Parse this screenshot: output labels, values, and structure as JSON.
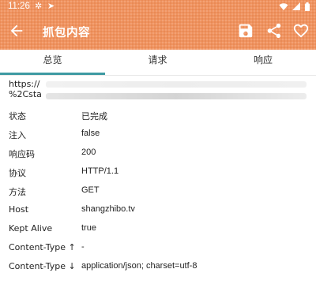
{
  "statusbar": {
    "time": "11:26"
  },
  "appbar": {
    "title": "抓包内容",
    "color": "#f0935f",
    "icons": [
      "arrow-back-icon",
      "save-icon",
      "share-icon",
      "heart-icon"
    ]
  },
  "tabs": [
    {
      "label": "总览",
      "selected": true
    },
    {
      "label": "请求",
      "selected": false
    },
    {
      "label": "响应",
      "selected": false
    }
  ],
  "url": {
    "line1": "https://",
    "line2": "%2Csta"
  },
  "details": [
    {
      "label": "状态",
      "value": "已完成"
    },
    {
      "label": "注入",
      "value": "false"
    },
    {
      "label": "响应码",
      "value": "200"
    },
    {
      "label": "协议",
      "value": "HTTP/1.1"
    },
    {
      "label": "方法",
      "value": "GET"
    },
    {
      "label": "Host",
      "value": "shangzhibo.tv"
    },
    {
      "label": "Kept Alive",
      "value": "true"
    },
    {
      "label": "Content-Type ↑",
      "value": "-"
    },
    {
      "label": "Content-Type ↓",
      "value": "application/json; charset=utf-8"
    }
  ],
  "colors": {
    "accent": "#3e9aa2",
    "toolbar": "#f0935f"
  }
}
